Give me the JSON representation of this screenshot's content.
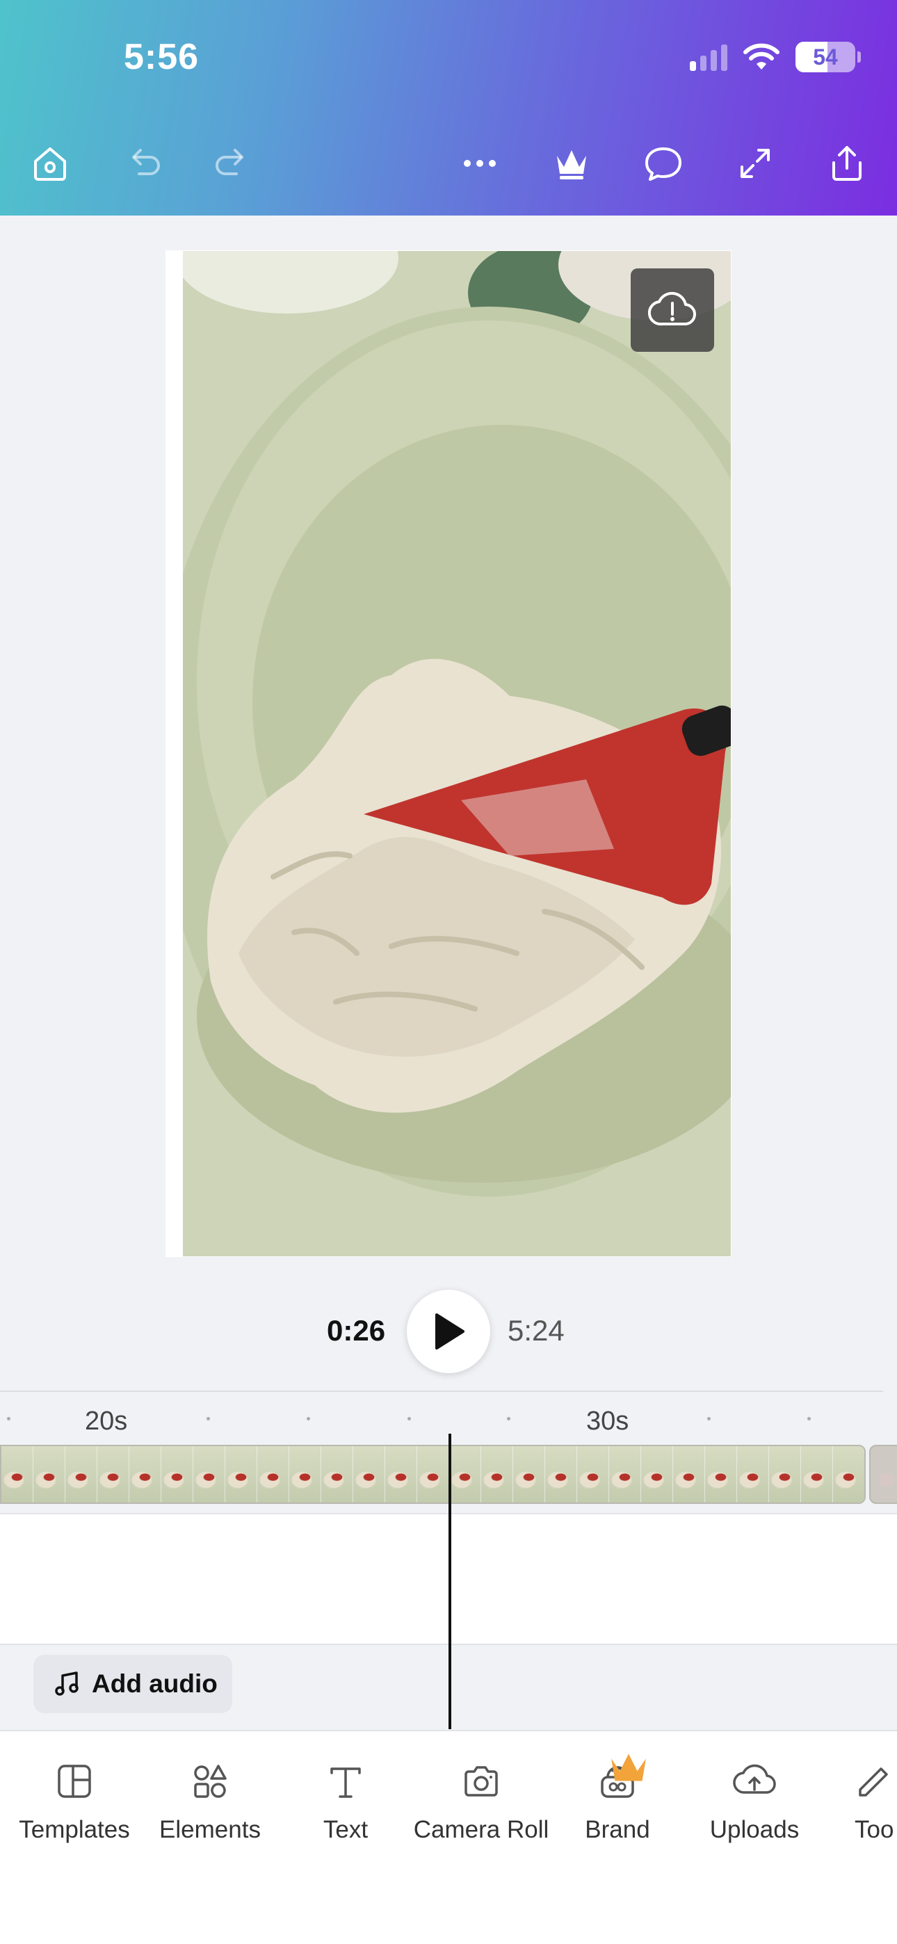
{
  "status_bar": {
    "time": "5:56",
    "battery_percent": 54,
    "battery_label": "54",
    "icons": [
      "cellular-signal-icon",
      "wifi-icon",
      "battery-icon"
    ]
  },
  "toolbar": {
    "icons": [
      "home-icon",
      "undo-icon",
      "redo-icon",
      "more-icon",
      "crown-icon",
      "comment-icon",
      "expand-icon",
      "share-icon"
    ]
  },
  "canvas": {
    "status_icon": "cloud-alert-icon"
  },
  "playback": {
    "current_time": "0:26",
    "total_duration": "5:24"
  },
  "timeline": {
    "tick_labels": [
      "20s",
      "30s"
    ],
    "add_audio_label": "Add audio"
  },
  "bottom_nav": {
    "items": [
      {
        "label": "Templates",
        "icon": "templates-icon"
      },
      {
        "label": "Elements",
        "icon": "elements-icon"
      },
      {
        "label": "Text",
        "icon": "text-icon"
      },
      {
        "label": "Camera Roll",
        "icon": "camera-icon"
      },
      {
        "label": "Brand",
        "icon": "brand-icon",
        "badge": "crown-icon"
      },
      {
        "label": "Uploads",
        "icon": "uploads-icon"
      },
      {
        "label": "Too",
        "icon": "tools-icon"
      }
    ]
  },
  "colors": {
    "header_gradient_start": "#4fc3cb",
    "header_gradient_end": "#7b2ee0",
    "premium_crown": "#f2a33a"
  }
}
